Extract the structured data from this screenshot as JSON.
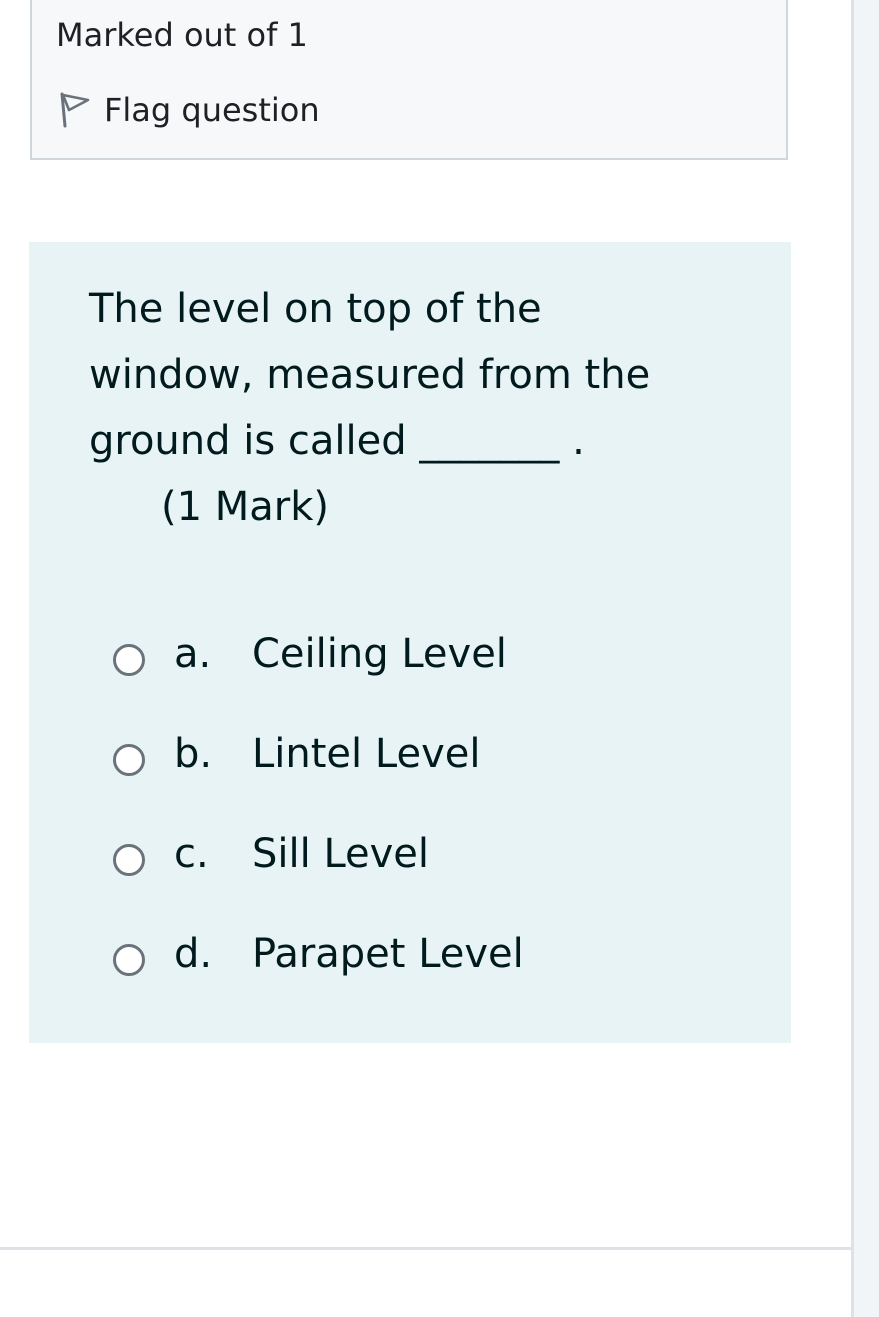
{
  "info": {
    "marks_text": "Marked out of 1",
    "flag_label": "Flag question"
  },
  "question": {
    "lines": [
      "The level on top of the",
      "window, measured from the",
      "ground is called _______ ."
    ],
    "mark_note": "(1 Mark)",
    "options": [
      {
        "letter": "a.",
        "text": "Ceiling Level",
        "selected": false
      },
      {
        "letter": "b.",
        "text": "Lintel Level",
        "selected": false
      },
      {
        "letter": "c.",
        "text": "Sill Level",
        "selected": false
      },
      {
        "letter": "d.",
        "text": "Parapet Level",
        "selected": false
      }
    ]
  },
  "colors": {
    "info_background": "#f7f8fa",
    "question_background": "#e7f3f5",
    "radio_border": "#6a737b",
    "text": "#001a1e"
  },
  "icons": {
    "flag": "flag-icon",
    "radio": "radio-circle"
  }
}
